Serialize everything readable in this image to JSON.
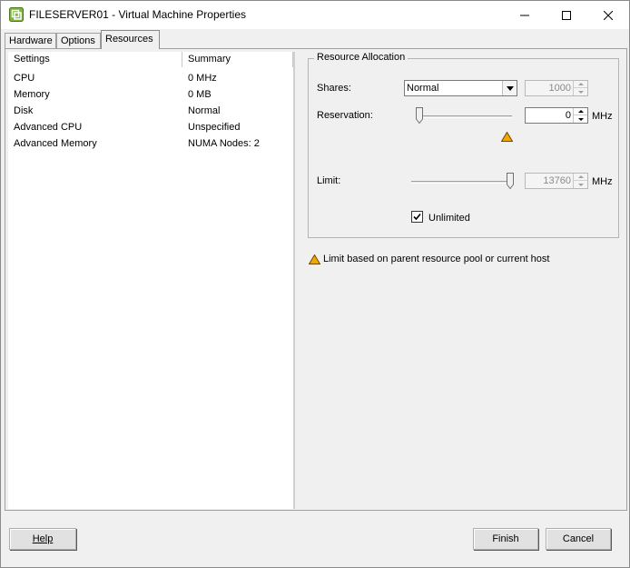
{
  "window": {
    "title": "FILESERVER01 - Virtual Machine Properties",
    "icon": "vm-properties-icon",
    "minimize_icon": "minimize-icon",
    "maximize_icon": "maximize-icon",
    "close_icon": "close-icon"
  },
  "tabs": [
    {
      "label": "Hardware",
      "active": false
    },
    {
      "label": "Options",
      "active": false
    },
    {
      "label": "Resources",
      "active": true
    }
  ],
  "list": {
    "headers": [
      "Settings",
      "Summary"
    ],
    "rows": [
      {
        "setting": "CPU",
        "summary": "0 MHz"
      },
      {
        "setting": "Memory",
        "summary": "0 MB"
      },
      {
        "setting": "Disk",
        "summary": "Normal"
      },
      {
        "setting": "Advanced CPU",
        "summary": "Unspecified"
      },
      {
        "setting": "Advanced Memory",
        "summary": "NUMA Nodes: 2"
      }
    ]
  },
  "resource_allocation": {
    "legend": "Resource Allocation",
    "shares_label": "Shares:",
    "shares_value": "Normal",
    "shares_number": "1000",
    "reservation_label": "Reservation:",
    "reservation_value": "0",
    "reservation_unit": "MHz",
    "reservation_slider_fraction": 0.0,
    "limit_label": "Limit:",
    "limit_value": "13760",
    "limit_unit": "MHz",
    "limit_slider_fraction": 1.0,
    "unlimited_label": "Unlimited",
    "unlimited_checked": true
  },
  "warning": {
    "icon": "warning-icon",
    "text": "Limit based on parent resource pool or current host",
    "color": "#f2a600"
  },
  "buttons": {
    "help": "Help",
    "finish": "Finish",
    "cancel": "Cancel"
  }
}
